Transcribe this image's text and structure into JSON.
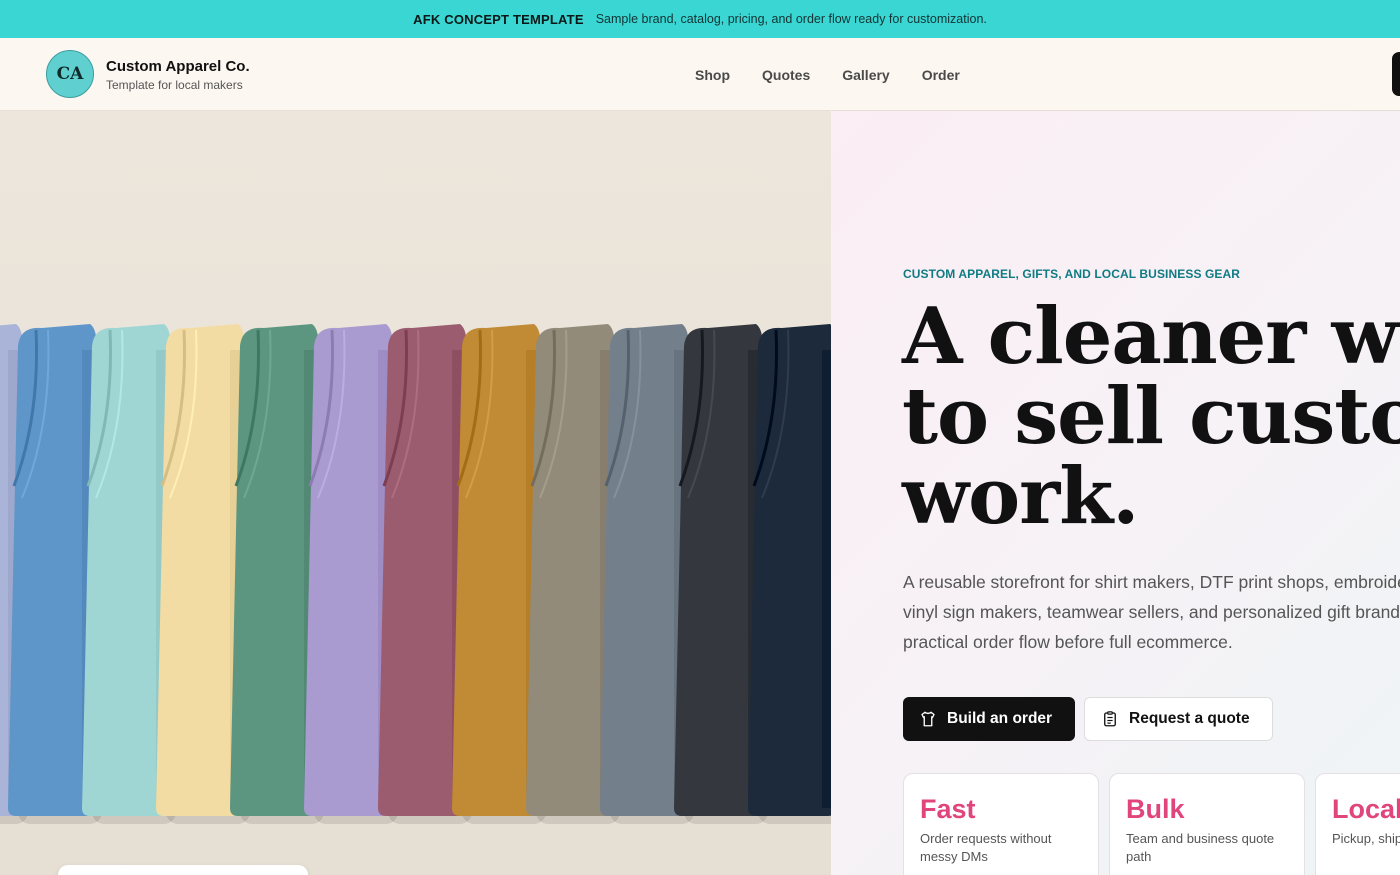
{
  "announcement": {
    "title": "AFK CONCEPT TEMPLATE",
    "message": "Sample brand, catalog, pricing, and order flow ready for customization."
  },
  "brand": {
    "initials": "CA",
    "name": "Custom Apparel Co.",
    "tagline": "Template for local makers"
  },
  "nav": {
    "items": [
      "Shop",
      "Quotes",
      "Gallery",
      "Order"
    ]
  },
  "hero": {
    "eyebrow": "CUSTOM APPAREL, GIFTS, AND LOCAL BUSINESS GEAR",
    "headline_lines": [
      "A cleaner w",
      "to sell custo",
      "work."
    ],
    "lead_lines": [
      "A reusable storefront for shirt makers, DTF print shops, embroide",
      "vinyl sign makers, teamwear sellers, and personalized gift brand",
      "practical order flow before full ecommerce."
    ],
    "primary_cta": "Build an order",
    "secondary_cta": "Request a quote",
    "stats": [
      {
        "title": "Fast",
        "desc": "Order requests without messy DMs"
      },
      {
        "title": "Bulk",
        "desc": "Team and business quote path"
      },
      {
        "title": "Local",
        "desc": "Pickup, shipping notes"
      }
    ]
  },
  "colors": {
    "announce_bg": "#3ad6d3",
    "accent_pink": "#e0457b",
    "accent_teal": "#0f7b83"
  },
  "shirt_colors": [
    "#a9b4d8",
    "#5f96c9",
    "#9fd6d4",
    "#f3dca3",
    "#5d9680",
    "#a99ad0",
    "#9b5c6f",
    "#c18a34",
    "#938b7a",
    "#747f8c",
    "#34383e",
    "#1c2a3c"
  ]
}
